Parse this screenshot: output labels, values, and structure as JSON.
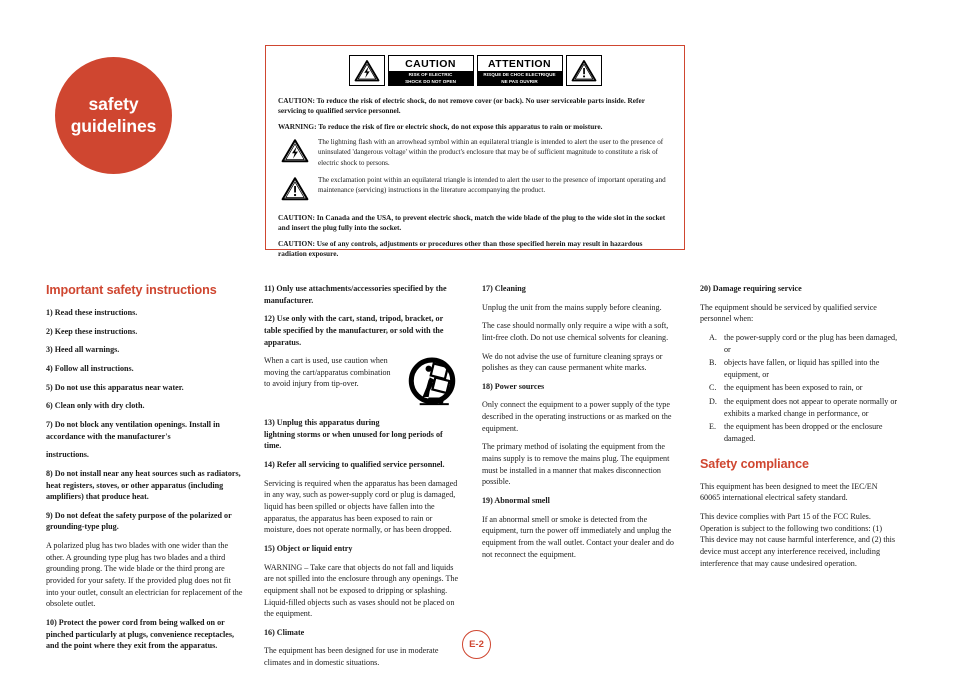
{
  "page": {
    "title_line1": "safety",
    "title_line2": "guidelines",
    "badge": "E-2",
    "accent_color": "#cf4630"
  },
  "caution_box": {
    "labels": {
      "caution_word": "CAUTION",
      "caution_sub_line1": "RISK OF ELECTRIC",
      "caution_sub_line2": "SHOCK DO NOT OPEN",
      "attention_word": "ATTENTION",
      "attention_sub_line1": "RISQUE DE CHOC ELECTRIQUE",
      "attention_sub_line2": "NE PAS OUVRIR"
    },
    "caution_main": "CAUTION: To reduce the risk of electric shock, do not remove cover (or back). No user serviceable parts inside. Refer servicing to qualified service personnel.",
    "warning_main": "WARNING: To reduce the risk of fire or electric shock, do not expose this apparatus to rain or moisture.",
    "lightning_text": "The lightning flash with an arrowhead symbol within an equilateral triangle is intended to alert the user to the presence of uninsulated 'dangerous voltage' within the product's enclosure that may be of sufficient magnitude to constitute a risk of electric shock to persons.",
    "exclamation_text": "The exclamation point within an equilateral triangle is intended to alert the user to the presence of important operating and maintenance (servicing) instructions in the literature accompanying the product.",
    "caution_canada": "CAUTION: In Canada and the USA, to prevent electric shock, match the wide blade of the plug to the wide slot in the socket and insert the plug fully into the socket.",
    "caution_radiation": "CAUTION: Use of any controls, adjustments or procedures other than those specified herein may result in hazardous radiation exposure."
  },
  "col1": {
    "heading": "Important safety instructions",
    "i1": "1) Read these instructions.",
    "i2": "2) Keep these instructions.",
    "i3": "3) Heed all warnings.",
    "i4": "4) Follow all instructions.",
    "i5": "5) Do not use this apparatus near water.",
    "i6": "6) Clean only with dry cloth.",
    "i7a": "7) Do not block any ventilation openings. Install in accordance with the manufacturer's",
    "i7b": "instructions.",
    "i8": "8) Do not install near any heat sources such as radiators, heat registers, stoves, or other apparatus (including amplifiers) that produce heat.",
    "i9": "9) Do not defeat the safety purpose of the polarized or grounding-type plug.",
    "i9body": "A polarized plug has two blades with one wider than the other. A grounding type plug has two blades and a third grounding prong. The wide blade or the third prong are provided for your safety. If the provided plug does not fit into your outlet, consult an electrician for replacement of the obsolete outlet.",
    "i10": "10) Protect the power cord from being walked on or pinched particularly at plugs, convenience receptacles, and the point where they exit from the apparatus."
  },
  "col2": {
    "i11": "11) Only use attachments/accessories specified by the manufacturer.",
    "i12": "12) Use only with the cart, stand, tripod, bracket, or table specified by the manufacturer, or sold with the apparatus.",
    "i12body": "When a cart is used, use caution when moving the cart/apparatus combination to avoid injury from tip-over.",
    "i13": "13) Unplug this apparatus during lightning storms or when unused for long periods of time.",
    "i14": "14) Refer all servicing to qualified service personnel.",
    "i14body": "Servicing is required when the apparatus has been damaged in any way, such as power-supply cord or plug is damaged, liquid has been spilled or objects have fallen into the apparatus, the apparatus has been exposed to rain or moisture, does not operate normally, or has been dropped.",
    "i15": "15) Object or liquid entry",
    "i15body": "WARNING – Take care that objects do not fall and liquids are not spilled into the enclosure through any openings. The equipment shall not be exposed to dripping or splashing. Liquid-filled objects such as vases should not be placed on the equipment.",
    "i16": "16)  Climate",
    "i16body": "The equipment has been designed for use in moderate climates and in domestic situations."
  },
  "col3": {
    "i17": "17) Cleaning",
    "i17body1": "Unplug the unit from the mains supply before cleaning.",
    "i17body2": "The case should normally only require a wipe with a soft, lint-free cloth. Do not use chemical solvents for cleaning.",
    "i17body3": "We do not advise the use of furniture cleaning sprays or polishes as they can cause permanent white marks.",
    "i18": "18) Power sources",
    "i18body1": "Only connect the equipment to a power supply of the type described in the operating instructions or as marked on the equipment.",
    "i18body2": "The primary method of isolating the equipment from the mains supply is to remove the mains plug. The equipment must be installed in a manner that makes disconnection possible.",
    "i19": "19) Abnormal smell",
    "i19body": "If an abnormal smell or smoke is detected from the equipment, turn the power off immediately and unplug the equipment from the wall outlet. Contact your dealer and do not reconnect the equipment."
  },
  "col4": {
    "i20": "20) Damage requiring service",
    "i20body": "The equipment should be serviced by qualified service personnel when:",
    "items": [
      "the power-supply cord or the plug has been damaged, or",
      "objects have fallen, or liquid has spilled into the equipment, or",
      "the equipment has been exposed to rain, or",
      "the equipment does not appear to operate normally or exhibits a marked change in performance, or",
      "the equipment has been dropped or the enclosure damaged."
    ],
    "compliance_heading": "Safety compliance",
    "compliance_p1": "This equipment has been designed to meet the IEC/EN 60065 international electrical safety standard.",
    "compliance_p2": "This device complies with Part 15 of the FCC Rules. Operation is subject to the following two conditions: (1) This device may not cause harmful interference, and (2) this device must accept any interference received, including interference that may cause undesired operation."
  }
}
